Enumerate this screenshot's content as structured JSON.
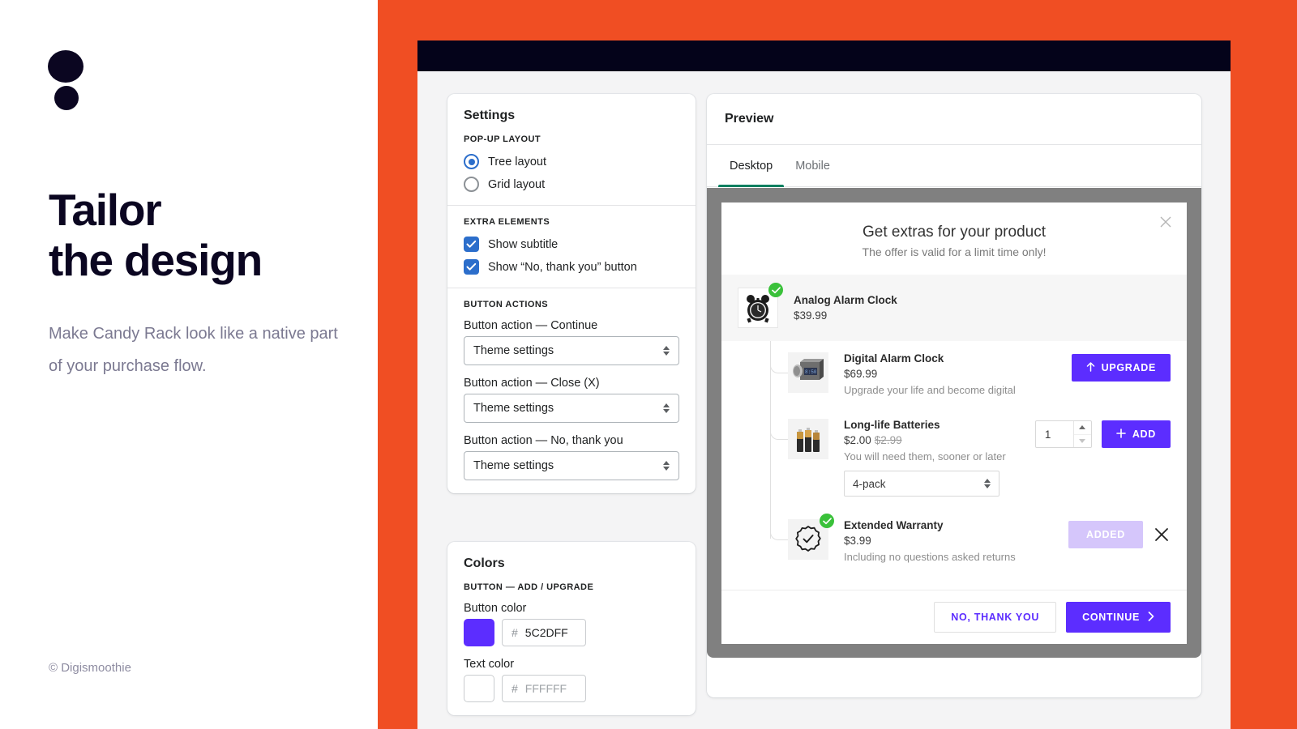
{
  "promo": {
    "logo_icon": "two-dots-logo",
    "title_line1": "Tailor",
    "title_line2": "the design",
    "subtitle": "Make Candy Rack look like a native part of your purchase flow.",
    "footer": "© Digismoothie",
    "accent_color": "#F04E23",
    "ink_color": "#0B0621"
  },
  "settings": {
    "title": "Settings",
    "popup_layout": {
      "label": "POP-UP LAYOUT",
      "options": [
        {
          "label": "Tree layout",
          "selected": true
        },
        {
          "label": "Grid layout",
          "selected": false
        }
      ]
    },
    "extra_elements": {
      "label": "EXTRA ELEMENTS",
      "options": [
        {
          "label": "Show subtitle",
          "checked": true
        },
        {
          "label": "Show “No, thank you” button",
          "checked": true
        }
      ]
    },
    "button_actions": {
      "label": "BUTTON ACTIONS",
      "fields": [
        {
          "label": "Button action — Continue",
          "value": "Theme settings"
        },
        {
          "label": "Button action — Close (X)",
          "value": "Theme settings"
        },
        {
          "label": "Button action — No, thank you",
          "value": "Theme settings"
        }
      ]
    }
  },
  "colors": {
    "title": "Colors",
    "group_label": "BUTTON — ADD / UPGRADE",
    "fields": [
      {
        "label": "Button color",
        "hash": "#",
        "value": "5C2DFF",
        "swatch": "#5C2DFF",
        "is_placeholder": false
      },
      {
        "label": "Text color",
        "hash": "#",
        "value": "FFFFFF",
        "swatch": "#FFFFFF",
        "is_placeholder": true
      }
    ]
  },
  "preview": {
    "title": "Preview",
    "tabs": [
      {
        "label": "Desktop",
        "active": true
      },
      {
        "label": "Mobile",
        "active": false
      }
    ],
    "active_tab_color": "#008060"
  },
  "popup": {
    "title": "Get extras for your product",
    "subtitle": "The offer is valid for a limit time only!",
    "close_icon": "close-x-icon",
    "parent_product": {
      "name": "Analog Alarm Clock",
      "price": "$39.99",
      "thumb_icon": "analog-alarm-clock-thumb",
      "selected_badge": "check-circle-icon"
    },
    "children": [
      {
        "name": "Digital Alarm Clock",
        "price": "$69.99",
        "compare_price": "",
        "description": "Upgrade your life and become digital",
        "thumb_icon": "digital-alarm-clock-thumb",
        "action_type": "upgrade",
        "action_label": "UPGRADE",
        "action_icon": "arrow-up-icon"
      },
      {
        "name": "Long-life Batteries",
        "price": "$2.00",
        "compare_price": "$2.99",
        "description": "You will need them, sooner or later",
        "thumb_icon": "batteries-thumb",
        "action_type": "add",
        "action_label": "ADD",
        "action_icon": "plus-icon",
        "quantity": "1",
        "variant": "4-pack"
      },
      {
        "name": "Extended Warranty",
        "price": "$3.99",
        "compare_price": "",
        "description": "Including no questions asked returns",
        "thumb_icon": "warranty-seal-icon",
        "action_type": "added",
        "action_label": "ADDED",
        "selected_badge": "check-circle-icon",
        "remove_icon": "close-x-icon"
      }
    ],
    "footer": {
      "decline_label": "NO, THANK YOU",
      "continue_label": "CONTINUE",
      "continue_icon": "chevron-right-icon"
    },
    "button_color": "#5C2DFF"
  }
}
